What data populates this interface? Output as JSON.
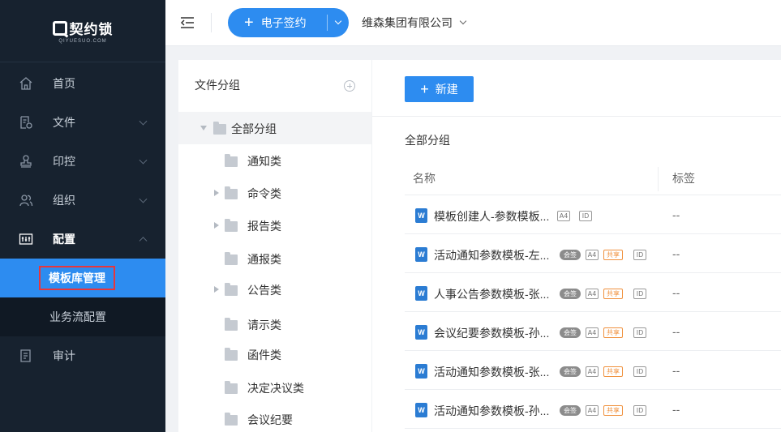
{
  "logo": {
    "text": "契约锁",
    "subtitle": "QIYUESUO.COM"
  },
  "sidebar": {
    "items": [
      {
        "label": "首页",
        "icon": "home-icon"
      },
      {
        "label": "文件",
        "icon": "file-icon"
      },
      {
        "label": "印控",
        "icon": "seal-icon"
      },
      {
        "label": "组织",
        "icon": "users-icon"
      },
      {
        "label": "配置",
        "icon": "settings-icon"
      },
      {
        "label": "审计",
        "icon": "audit-icon"
      }
    ],
    "sub_items": [
      {
        "label": "模板库管理"
      },
      {
        "label": "业务流配置"
      }
    ]
  },
  "topbar": {
    "esign_label": "电子签约",
    "company": "维森集团有限公司"
  },
  "group_panel": {
    "title": "文件分组",
    "tree": [
      {
        "label": "全部分组"
      },
      {
        "label": "通知类"
      },
      {
        "label": "命令类"
      },
      {
        "label": "报告类"
      },
      {
        "label": "通报类"
      },
      {
        "label": "公告类"
      },
      {
        "label": "请示类"
      },
      {
        "label": "函件类"
      },
      {
        "label": "决定决议类"
      },
      {
        "label": "会议纪要"
      }
    ]
  },
  "main": {
    "new_button": "新建",
    "section_title": "全部分组",
    "columns": {
      "name": "名称",
      "tag": "标签"
    },
    "badges": {
      "sign": "会签",
      "a4": "A4",
      "share": "共享",
      "id": "ID"
    },
    "file_icon_letter": "W",
    "rows": [
      {
        "name": "模板创建人-参数模板...",
        "tag": "--"
      },
      {
        "name": "活动通知参数模板-左...",
        "tag": "--"
      },
      {
        "name": "人事公告参数模板-张...",
        "tag": "--"
      },
      {
        "name": "会议纪要参数模板-孙...",
        "tag": "--"
      },
      {
        "name": "活动通知参数模板-张...",
        "tag": "--"
      },
      {
        "name": "活动通知参数模板-孙...",
        "tag": "--"
      }
    ]
  }
}
